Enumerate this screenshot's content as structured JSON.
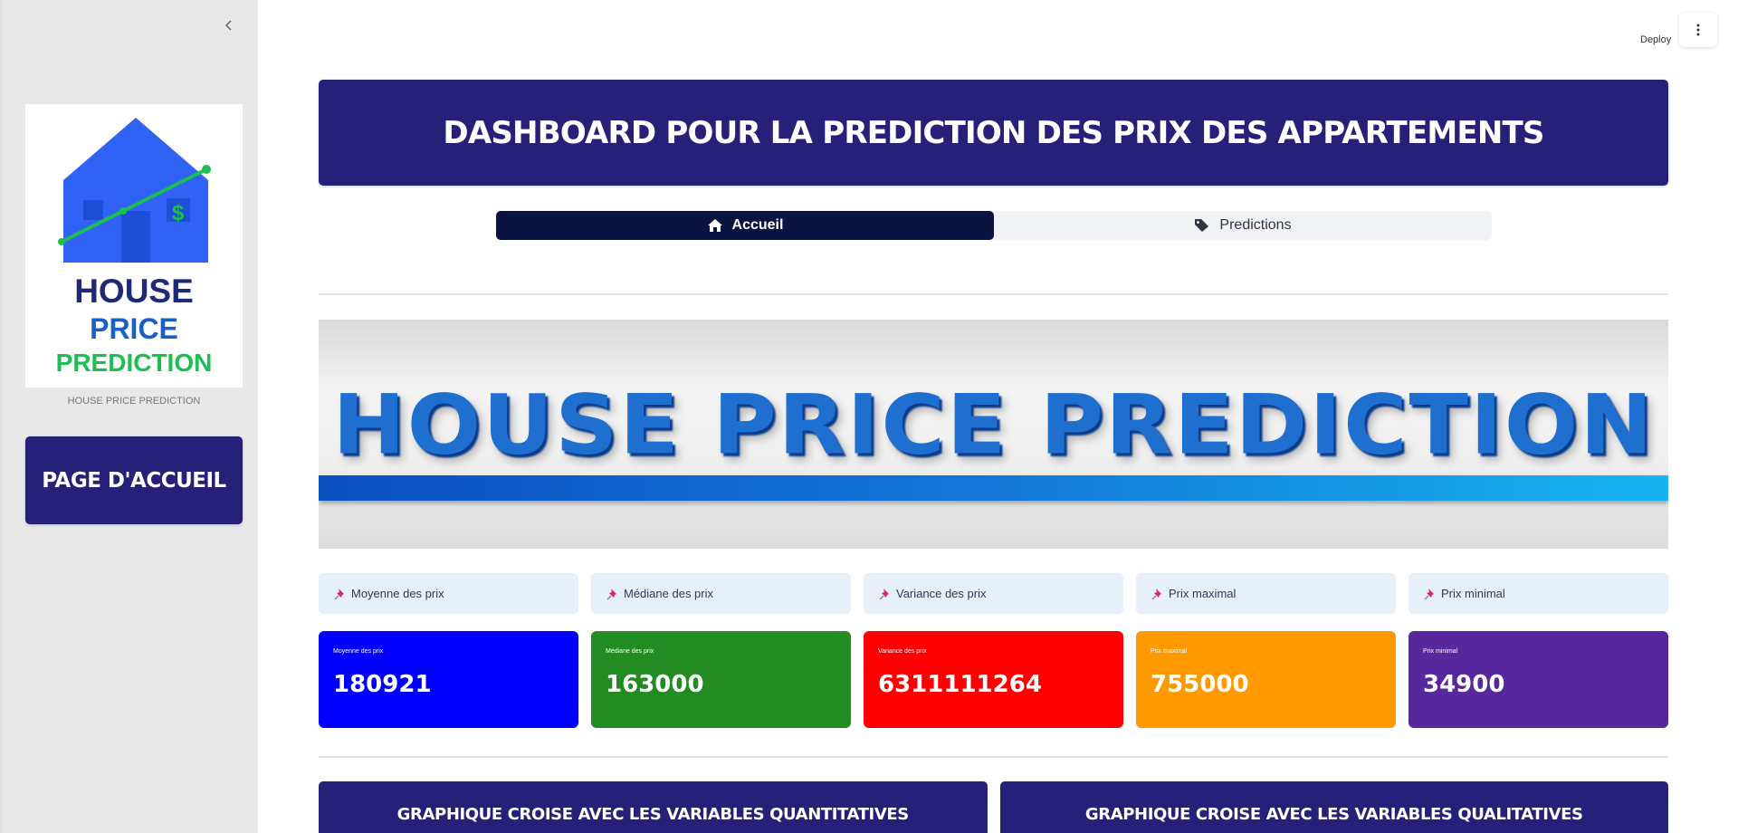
{
  "sidebar": {
    "collapse_icon": "chevron-left-icon",
    "logo": {
      "line1": "HOUSE",
      "line2": "PRICE",
      "line3": "PREDICTION"
    },
    "logo_caption": "HOUSE PRICE PREDICTION",
    "home_button_label": "PAGE D'ACCUEIL"
  },
  "toolbar": {
    "deploy_label": "Deploy",
    "menu_icon": "vertical-dots-icon"
  },
  "header": {
    "title": "DASHBOARD POUR LA PREDICTION DES PRIX DES APPARTEMENTS"
  },
  "tabs": [
    {
      "label": "Accueil",
      "icon": "house-icon",
      "active": true
    },
    {
      "label": "Predictions",
      "icon": "tags-icon",
      "active": false
    }
  ],
  "hero": {
    "text": "HOUSE PRICE PREDICTION"
  },
  "metric_labels": [
    {
      "label": "Moyenne des prix",
      "icon": "pushpin-icon"
    },
    {
      "label": "Médiane des prix",
      "icon": "pushpin-icon"
    },
    {
      "label": "Variance des prix",
      "icon": "pushpin-icon"
    },
    {
      "label": "Prix maximal",
      "icon": "pushpin-icon"
    },
    {
      "label": "Prix minimal",
      "icon": "pushpin-icon"
    }
  ],
  "metrics": [
    {
      "label": "Moyenne des prix",
      "value": "180921",
      "color": "#0000ff"
    },
    {
      "label": "Médiane des prix",
      "value": "163000",
      "color": "#228b22"
    },
    {
      "label": "Variance des prix",
      "value": "6311111264",
      "color": "#ff0000"
    },
    {
      "label": "Prix maximal",
      "value": "755000",
      "color": "#ff9900"
    },
    {
      "label": "Prix minimal",
      "value": "34900",
      "color": "#56279d"
    }
  ],
  "sections": [
    {
      "title": "GRAPHIQUE CROISE AVEC LES VARIABLES QUANTITATIVES"
    },
    {
      "title": "GRAPHIQUE CROISE AVEC LES VARIABLES QUALITATIVES"
    }
  ]
}
